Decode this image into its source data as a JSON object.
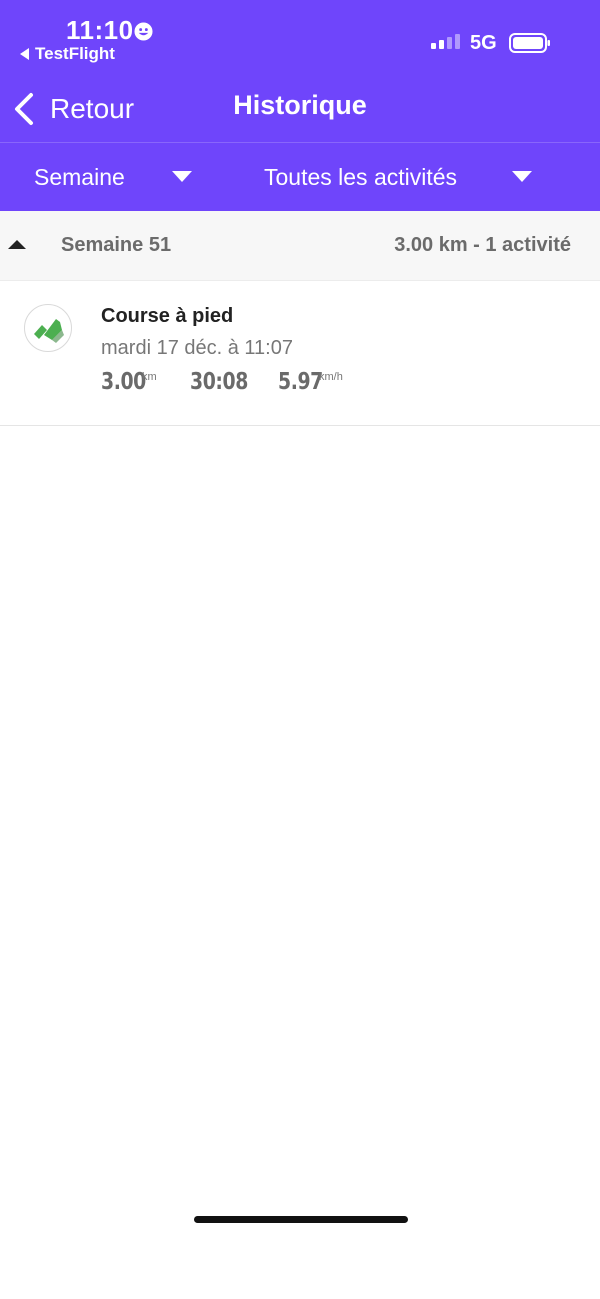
{
  "status_bar": {
    "time": "11:10",
    "back_app": "TestFlight",
    "network": "5G"
  },
  "nav": {
    "back_label": "Retour",
    "title": "Historique"
  },
  "filters": {
    "period": "Semaine",
    "activity_type": "Toutes les activités"
  },
  "week_group": {
    "label": "Semaine 51",
    "summary": "3.00 km - 1 activité"
  },
  "activities": [
    {
      "title": "Course à pied",
      "date": "mardi 17 déc.  à 11:07",
      "distance": "3.00",
      "distance_unit": "km",
      "duration": "30:08",
      "speed": "5.97",
      "speed_unit": "km/h"
    }
  ],
  "colors": {
    "header": "#6f45fb",
    "activity_icon": "#4caf50"
  }
}
